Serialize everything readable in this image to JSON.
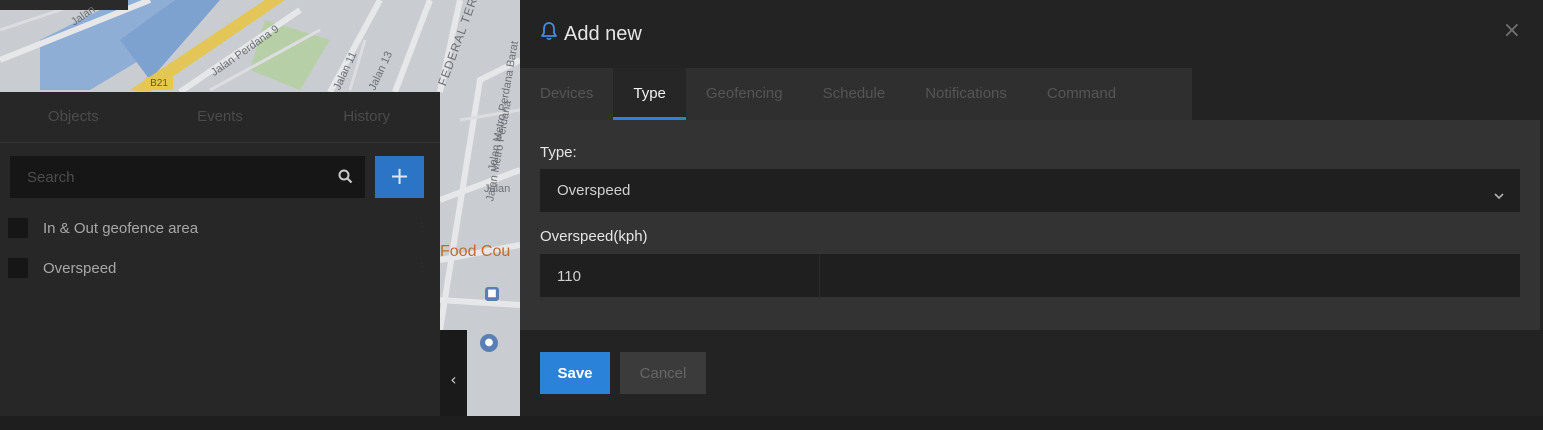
{
  "map": {
    "labels": {
      "perdana9": "Jalan Perdana 9",
      "jalan11": "Jalan 11",
      "jalan13": "Jalan 13",
      "federal": "FEDERAL TERR",
      "metro_barat": "Jalan Metro Perdana Barat",
      "metro": "Jalan Metro Perdana",
      "jalan": "Jalan",
      "road_badge": "B21",
      "food_court": "Food Cou"
    }
  },
  "sidebar": {
    "tabs": [
      "Objects",
      "Events",
      "History"
    ],
    "search": {
      "placeholder": "Search",
      "value": ""
    },
    "add_label": "+",
    "items": [
      {
        "label": "In & Out geofence area"
      },
      {
        "label": "Overspeed"
      }
    ],
    "collapse_label": "‹"
  },
  "modal": {
    "title": "Add new",
    "close_label": "×",
    "tabs": [
      {
        "label": "Devices",
        "active": false
      },
      {
        "label": "Type",
        "active": true
      },
      {
        "label": "Geofencing",
        "active": false
      },
      {
        "label": "Schedule",
        "active": false
      },
      {
        "label": "Notifications",
        "active": false
      },
      {
        "label": "Command",
        "active": false
      }
    ],
    "type_label": "Type:",
    "type_value": "Overspeed",
    "speed_label": "Overspeed(kph)",
    "speed_value": "110",
    "save_label": "Save",
    "cancel_label": "Cancel"
  },
  "colors": {
    "accent": "#2b82d9",
    "modal_bg": "#232323",
    "panel_bg": "#333333",
    "input_bg": "#1f1f1f"
  },
  "icons": {
    "title": "bell-icon",
    "close": "close-icon",
    "search": "search-icon",
    "select": "chevron-down-icon",
    "collapse": "chevron-left-icon"
  }
}
